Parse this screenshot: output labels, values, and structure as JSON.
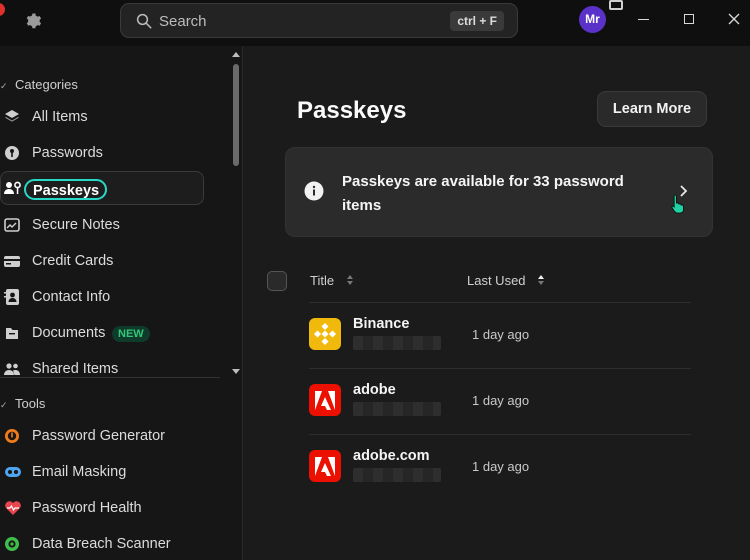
{
  "titlebar": {
    "search_placeholder": "Search",
    "search_shortcut": "ctrl + F",
    "avatar_initials": "Mr"
  },
  "sidebar": {
    "categories_label": "Categories",
    "tools_label": "Tools",
    "categories": [
      {
        "label": "All Items",
        "icon": "layers-icon"
      },
      {
        "label": "Passwords",
        "icon": "key-icon"
      },
      {
        "label": "Passkeys",
        "icon": "passkey-icon",
        "active": true
      },
      {
        "label": "Secure Notes",
        "icon": "note-icon"
      },
      {
        "label": "Credit Cards",
        "icon": "card-icon"
      },
      {
        "label": "Contact Info",
        "icon": "contact-icon"
      },
      {
        "label": "Documents",
        "icon": "document-icon",
        "badge": "NEW"
      },
      {
        "label": "Shared Items",
        "icon": "people-icon"
      }
    ],
    "tools": [
      {
        "label": "Password Generator",
        "icon": "generator-icon"
      },
      {
        "label": "Email Masking",
        "icon": "mask-icon"
      },
      {
        "label": "Password Health",
        "icon": "heart-icon"
      },
      {
        "label": "Data Breach Scanner",
        "icon": "scanner-icon"
      }
    ]
  },
  "main": {
    "title": "Passkeys",
    "learn_more": "Learn More",
    "banner_text": "Passkeys are available for 33 password items",
    "columns": {
      "title": "Title",
      "last_used": "Last Used"
    },
    "rows": [
      {
        "name": "Binance",
        "last_used": "1 day ago",
        "logo": "binance"
      },
      {
        "name": "adobe",
        "last_used": "1 day ago",
        "logo": "adobe"
      },
      {
        "name": "adobe.com",
        "last_used": "1 day ago",
        "logo": "adobe"
      }
    ]
  },
  "colors": {
    "accent_teal": "#29d9c8",
    "avatar": "#5b32c9",
    "binance": "#f0b90b",
    "adobe": "#eb1000",
    "new_badge": "#34c77a"
  }
}
